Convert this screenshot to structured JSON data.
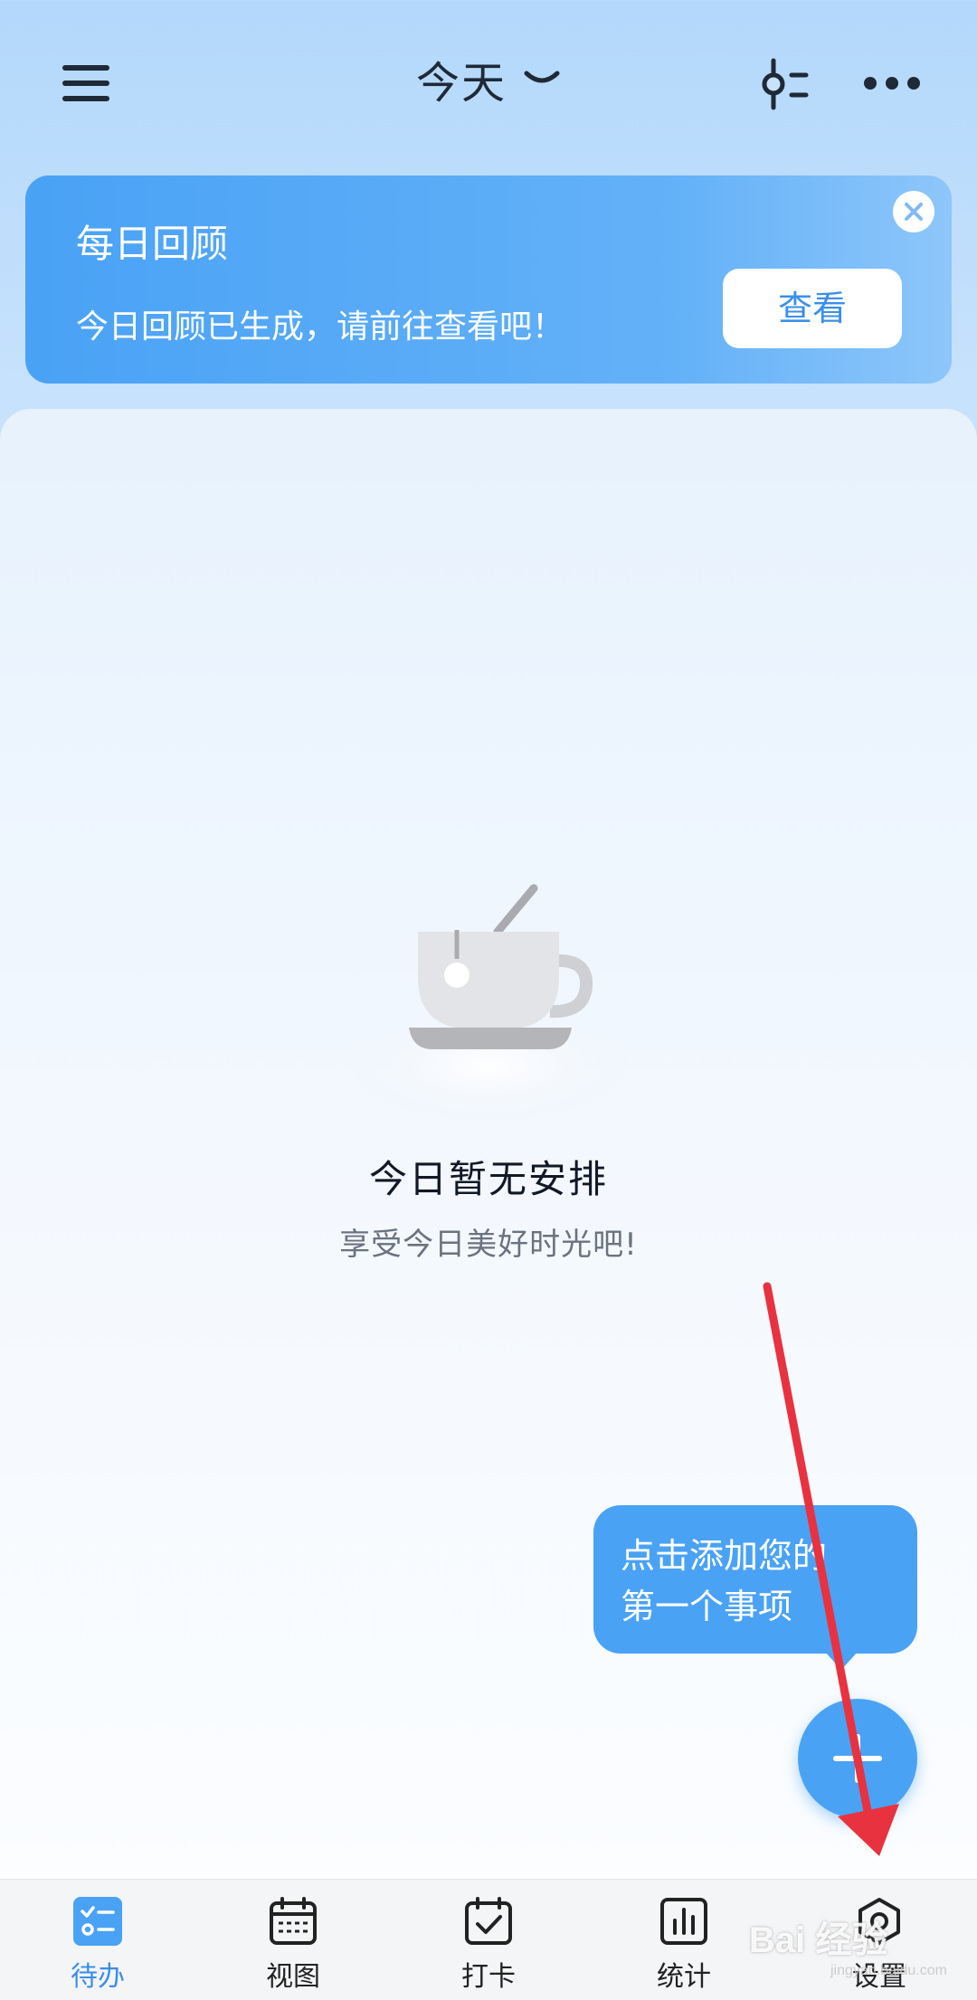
{
  "header": {
    "title": "今天",
    "menu_icon": "menu-icon",
    "filter_icon": "filter-icon",
    "more_icon": "more-icon"
  },
  "banner": {
    "title": "每日回顾",
    "text": "今日回顾已生成，请前往查看吧！",
    "button_label": "查看",
    "close_icon": "close-icon"
  },
  "empty_state": {
    "illustration": "coffee-cup-icon",
    "title": "今日暂无安排",
    "subtitle": "享受今日美好时光吧!"
  },
  "tooltip": {
    "line1": "点击添加您的",
    "line2": "第一个事项"
  },
  "fab": {
    "icon": "plus-icon"
  },
  "tabbar": {
    "items": [
      {
        "label": "待办",
        "icon": "todo-icon",
        "active": true
      },
      {
        "label": "视图",
        "icon": "calendar-icon",
        "active": false
      },
      {
        "label": "打卡",
        "icon": "checkin-icon",
        "active": false
      },
      {
        "label": "统计",
        "icon": "stats-icon",
        "active": false
      },
      {
        "label": "设置",
        "icon": "settings-icon",
        "active": false
      }
    ]
  },
  "watermark": {
    "main": "Bai 经验",
    "sub": "jingyan.baidu.com"
  },
  "colors": {
    "accent": "#4aa2f5",
    "banner_start": "#4aa2f5",
    "arrow": "#e8323f",
    "text_dark": "#1f2937",
    "text_muted": "#6b7280"
  }
}
